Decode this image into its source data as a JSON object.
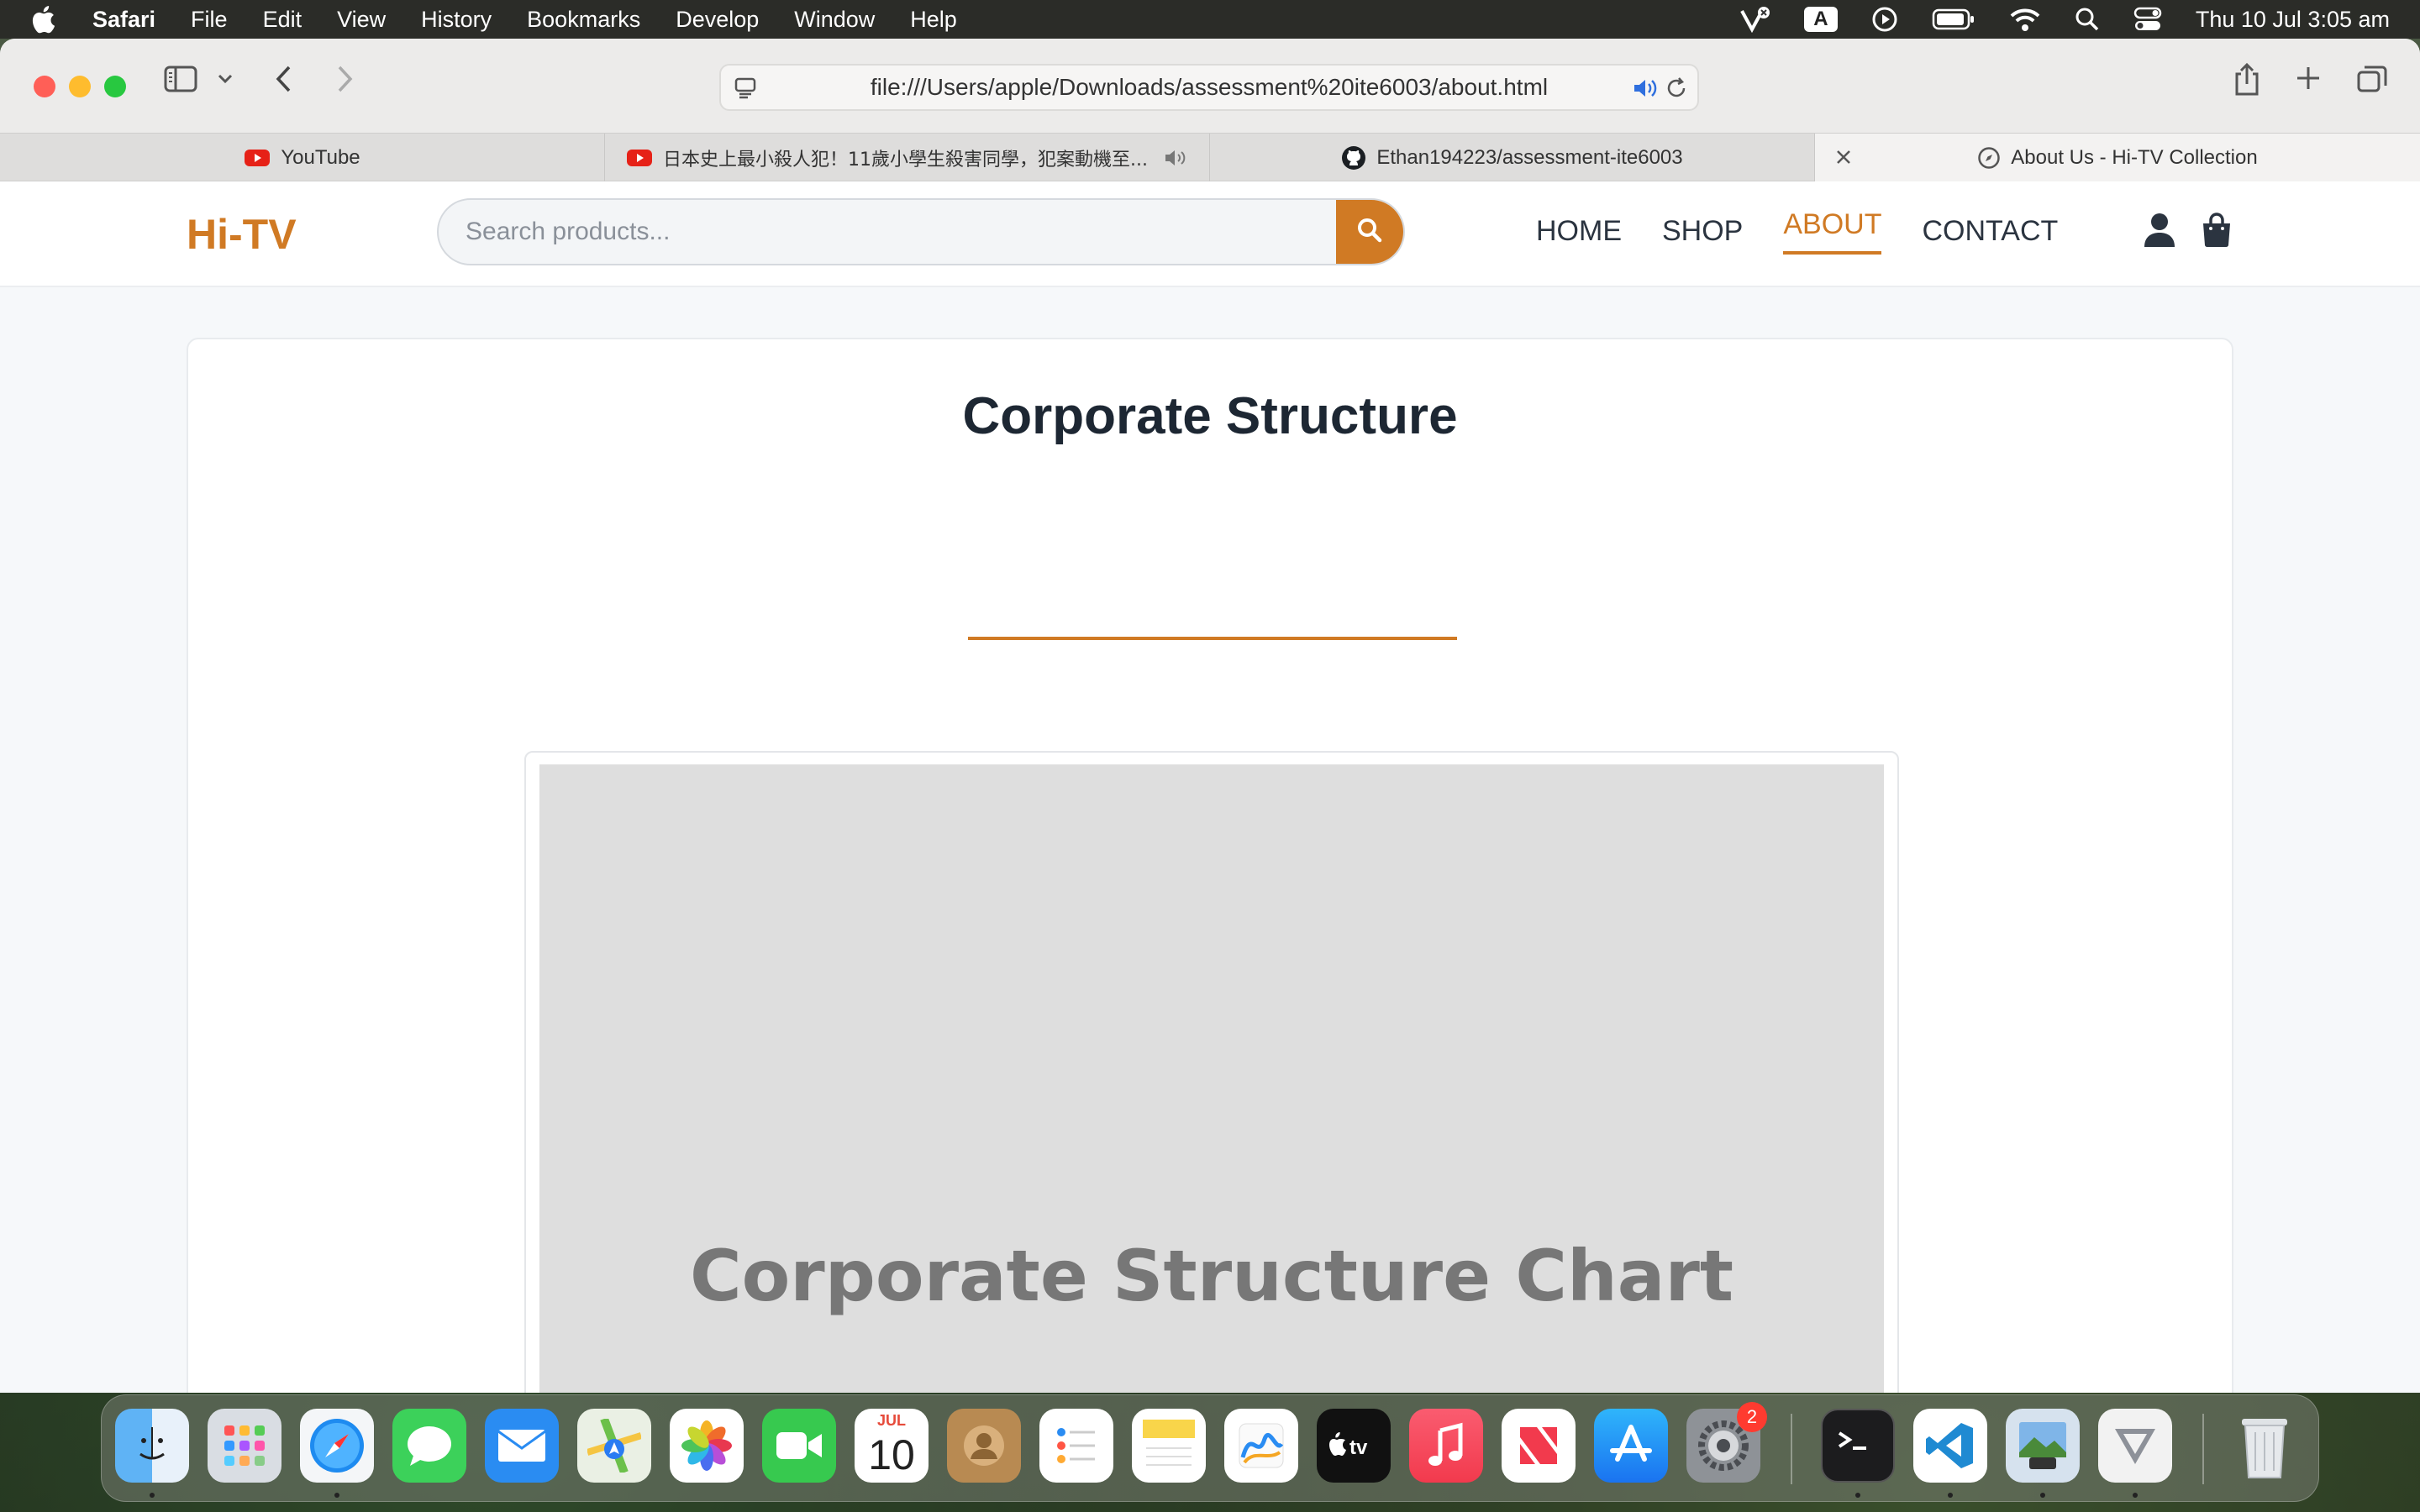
{
  "menubar": {
    "app_name": "Safari",
    "menus": [
      "File",
      "Edit",
      "View",
      "History",
      "Bookmarks",
      "Develop",
      "Window",
      "Help"
    ],
    "input_source": "A",
    "clock": "Thu 10 Jul  3:05 am"
  },
  "browser": {
    "url": "file:///Users/apple/Downloads/assessment%20ite6003/about.html",
    "tabs": [
      {
        "label": "YouTube",
        "icon": "youtube-icon",
        "active": false
      },
      {
        "label": "日本史上最小殺人犯！11歲小學生殺害同學，犯案動機至...",
        "icon": "youtube-icon",
        "active": false,
        "muted_audio": true
      },
      {
        "label": "Ethan194223/assessment-ite6003",
        "icon": "github-icon",
        "active": false
      },
      {
        "label": "About Us - Hi-TV Collection",
        "icon": "compass-icon",
        "active": true
      }
    ]
  },
  "site": {
    "logo": "Hi-TV",
    "search_placeholder": "Search products...",
    "nav": [
      {
        "label": "HOME",
        "active": false
      },
      {
        "label": "SHOP",
        "active": false
      },
      {
        "label": "ABOUT",
        "active": true
      },
      {
        "label": "CONTACT",
        "active": false
      }
    ],
    "accent_color": "#d07a24"
  },
  "content": {
    "heading": "Corporate Structure",
    "chart_placeholder": "Corporate Structure Chart"
  },
  "dock": {
    "apps": [
      "Finder",
      "Launchpad",
      "Safari",
      "Messages",
      "Mail",
      "Maps",
      "Photos",
      "FaceTime",
      "Calendar",
      "Contacts",
      "Reminders",
      "Notes",
      "Freeform",
      "TV",
      "Music",
      "News",
      "App Store",
      "System Settings",
      "Terminal",
      "Visual Studio Code",
      "Preview",
      "Parallels",
      "Trash"
    ],
    "calendar_month": "JUL",
    "calendar_day": "10",
    "settings_badge": "2"
  }
}
